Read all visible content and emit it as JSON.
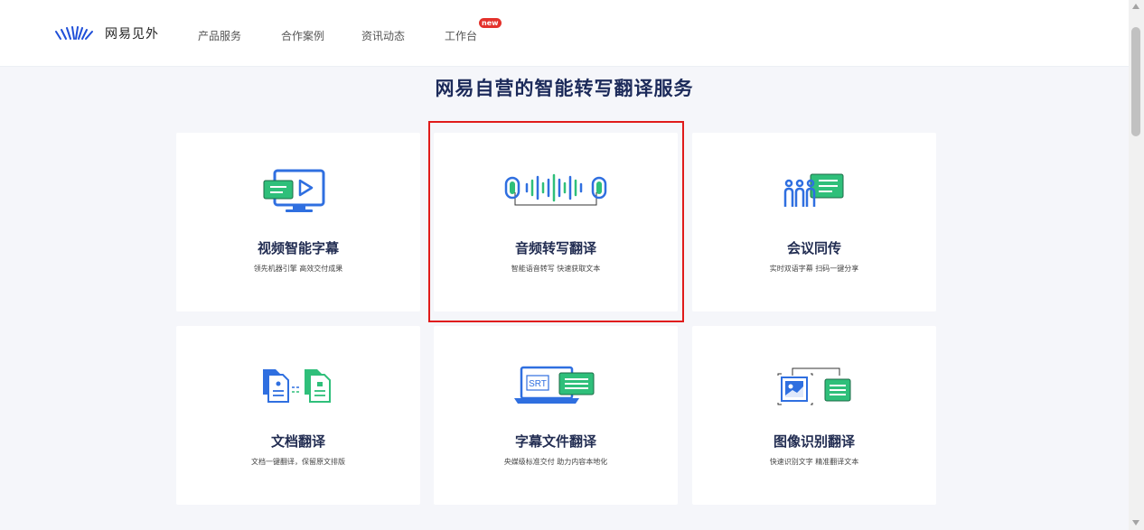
{
  "header": {
    "logo_text": "网易见外",
    "nav": [
      {
        "label": "产品服务"
      },
      {
        "label": "合作案例"
      },
      {
        "label": "资讯动态"
      },
      {
        "label": "工作台",
        "badge": "new"
      }
    ]
  },
  "main": {
    "title": "网易自营的智能转写翻译服务",
    "cards": [
      {
        "title": "视频智能字幕",
        "desc": "领先机器引擎 高效交付成果",
        "icon": "video-subtitle-icon"
      },
      {
        "title": "音频转写翻译",
        "desc": "智能语音转写 快速获取文本",
        "icon": "audio-transcribe-icon",
        "highlighted": true
      },
      {
        "title": "会议同传",
        "desc": "实时双语字幕 扫码一键分享",
        "icon": "meeting-interpret-icon"
      },
      {
        "title": "文档翻译",
        "desc": "文档一键翻译，保留原文排版",
        "icon": "document-translate-icon"
      },
      {
        "title": "字幕文件翻译",
        "desc": "央媒级标准交付 助力内容本地化",
        "icon": "subtitle-file-icon",
        "icon_label": "SRT"
      },
      {
        "title": "图像识别翻译",
        "desc": "快速识别文字 精准翻译文本",
        "icon": "image-recognition-icon"
      }
    ]
  },
  "colors": {
    "accent_blue": "#2f6fe0",
    "accent_green": "#2fbf7a",
    "navy_text": "#1c2a5a",
    "highlight_red": "#e01b1b",
    "badge_red": "#e4312b"
  }
}
